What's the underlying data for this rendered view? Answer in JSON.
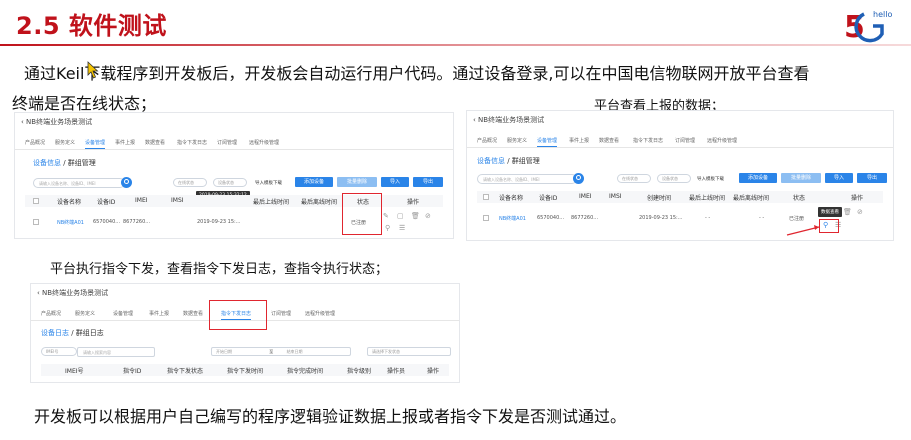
{
  "slide": {
    "title": "2.5 软件测试",
    "logo_text": "hello",
    "intro_line1": "通过Keil下载程序到开发板后，开发板会自动运行用户代码。通过设备登录,可以在中国电信物联网开放平台查看",
    "intro_line2": "终端是否在线状态；",
    "caption_report": "平台查看上报的数据；",
    "caption_command": "平台执行指令下发，查看指令下发日志，查指令执行状态；",
    "conclusion": "开发板可以根据用户自己编写的程序逻辑验证数据上报或者指令下发是否测试通过。"
  },
  "colors": {
    "title": "#c0121b",
    "accent": "#2a84e8",
    "highlight": "#e0262f"
  },
  "shot1": {
    "breadcrumb": "NB终端业务场景测试",
    "tabs": [
      "产品概况",
      "服务定义",
      "设备管理",
      "事件上报",
      "数据查看",
      "指令下发日志",
      "订阅管理",
      "远程升级管理"
    ],
    "subcrumb_link": "设备信息",
    "subcrumb_rest": " / 群组管理",
    "search_placeholder": "请输入设备名称、设备ID、IMEI",
    "filter1": "在线状态",
    "filter2": "设备状态",
    "import_template": "导入模板下载",
    "btn_add": "添加设备",
    "btn_batch_delete": "批量删除",
    "btn_import": "导入",
    "btn_export": "导出",
    "tooltip": "2019-09-23 15:32:12",
    "columns": [
      "设备名称",
      "设备ID",
      "IMEI",
      "IMSI",
      "创建时间",
      "最后上线时间",
      "最后离线时间",
      "状态",
      "操作"
    ],
    "row": {
      "name": "NB终端A01",
      "id": "6570040...",
      "imei": "8677260...",
      "created": "2019-09-23 15:...",
      "status": "已注册"
    }
  },
  "shot2": {
    "breadcrumb": "NB终端业务场景测试",
    "tabs": [
      "产品概况",
      "服务定义",
      "设备管理",
      "事件上报",
      "数据查看",
      "指令下发日志",
      "订阅管理",
      "远程升级管理"
    ],
    "subcrumb_link": "设备信息",
    "subcrumb_rest": " / 群组管理",
    "search_placeholder": "请输入设备名称、设备ID、IMEI",
    "filter1": "在线状态",
    "filter2": "设备状态",
    "import_template": "导入模板下载",
    "btn_add": "添加设备",
    "btn_batch_delete": "批量删除",
    "btn_import": "导入",
    "btn_export": "导出",
    "tooltip": "数据查看",
    "columns": [
      "设备名称",
      "设备ID",
      "IMEI",
      "IMSI",
      "创建时间",
      "最后上线时间",
      "最后离线时间",
      "状态",
      "操作"
    ],
    "row": {
      "name": "NB终端A01",
      "id": "6570040...",
      "imei": "8677260...",
      "created": "2019-09-23 15:...",
      "online": "- -",
      "offline": "- -",
      "status": "已注册"
    }
  },
  "shot3": {
    "breadcrumb": "NB终端业务场景测试",
    "tabs": [
      "产品概况",
      "服务定义",
      "设备管理",
      "事件上报",
      "数据查看",
      "指令下发日志",
      "订阅管理",
      "远程升级管理"
    ],
    "subcrumb_link": "设备日志",
    "subcrumb_rest": " / 群组日志",
    "select_type": "IMEI号",
    "search_placeholder": "请输入搜索内容",
    "date_start": "开始日期",
    "date_sep": "至",
    "date_end": "结束日期",
    "status_select": "请选择下发状态",
    "columns": [
      "IMEI号",
      "指令ID",
      "指令下发状态",
      "指令下发时间",
      "指令完成时间",
      "指令级别",
      "操作员",
      "操作"
    ]
  }
}
